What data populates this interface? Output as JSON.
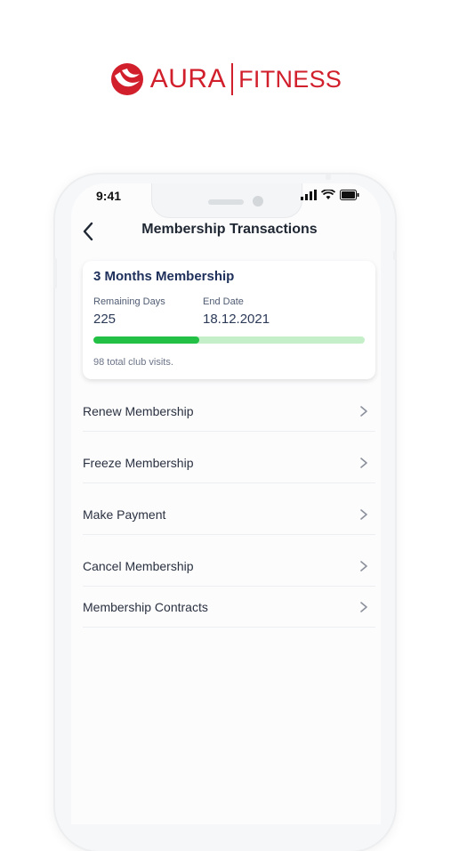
{
  "brand": {
    "word": "AURA",
    "sub": "FITNESS",
    "color": "#d11f2c"
  },
  "status": {
    "time": "9:41"
  },
  "header": {
    "title": "Membership Transactions"
  },
  "membership": {
    "title": "3 Months Membership",
    "remaining_label": "Remaining Days",
    "remaining_value": "225",
    "end_label": "End Date",
    "end_value": "18.12.2021",
    "progress_fraction": 0.39,
    "visits_text": "98 total club visits."
  },
  "menu": [
    {
      "label": "Renew Membership"
    },
    {
      "label": "Freeze Membership"
    },
    {
      "label": "Make Payment"
    },
    {
      "label": "Cancel Membership"
    },
    {
      "label": "Membership Contracts"
    }
  ],
  "colors": {
    "accent": "#22c045",
    "accent_track": "#c5efc8",
    "title": "#1d2f5a"
  },
  "icons": [
    "brand-logo-icon",
    "back-arrow-icon",
    "signal-icon",
    "wifi-icon",
    "battery-icon",
    "chevron-right-icon"
  ]
}
